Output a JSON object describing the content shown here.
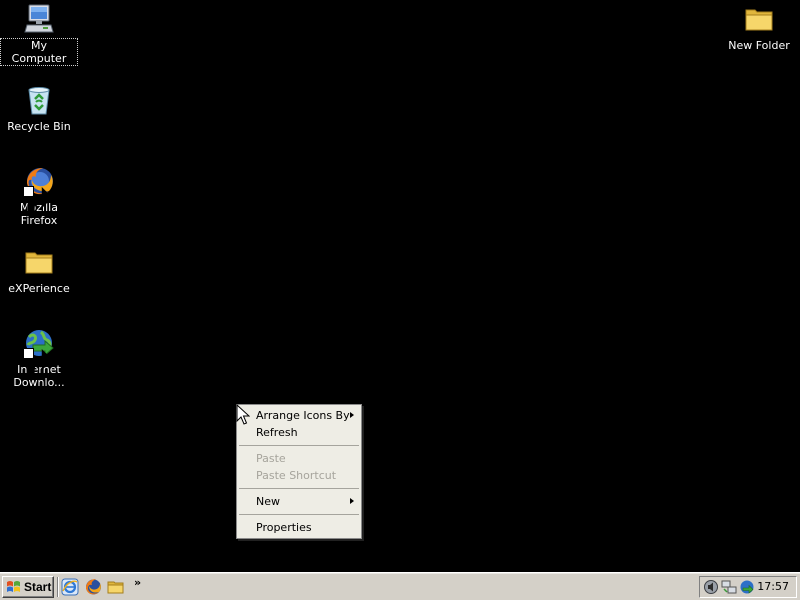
{
  "desktop": {
    "background_color": "#000000",
    "icons": [
      {
        "label": "My Computer",
        "icon": "my-computer-icon",
        "selected": true
      },
      {
        "label": "Recycle Bin",
        "icon": "recycle-bin-icon"
      },
      {
        "label": "Mozilla Firefox",
        "icon": "firefox-icon",
        "shortcut": true
      },
      {
        "label": "eXPerience",
        "icon": "folder-icon"
      },
      {
        "label": "Internet\nDownlo...",
        "icon": "internet-download-manager-icon",
        "shortcut": true
      },
      {
        "label": "New Folder",
        "icon": "folder-icon"
      }
    ]
  },
  "context_menu": {
    "items": [
      {
        "label": "Arrange Icons By",
        "submenu": true,
        "enabled": true
      },
      {
        "label": "Refresh",
        "enabled": true
      },
      {
        "label": "Paste",
        "enabled": false
      },
      {
        "label": "Paste Shortcut",
        "enabled": false
      },
      {
        "label": "New",
        "submenu": true,
        "enabled": true
      },
      {
        "label": "Properties",
        "enabled": true
      }
    ]
  },
  "taskbar": {
    "start_label": "Start",
    "quick_launch": [
      "internet-explorer-icon",
      "firefox-icon",
      "folder-icon"
    ],
    "chevron": "»",
    "tray_icons": [
      "volume-icon",
      "network-icon",
      "download-manager-icon"
    ],
    "clock": "17:57"
  },
  "colors": {
    "taskbar": "#d4d0c8",
    "menu_background": "#eeede5",
    "disabled_text": "#a6a49c"
  }
}
